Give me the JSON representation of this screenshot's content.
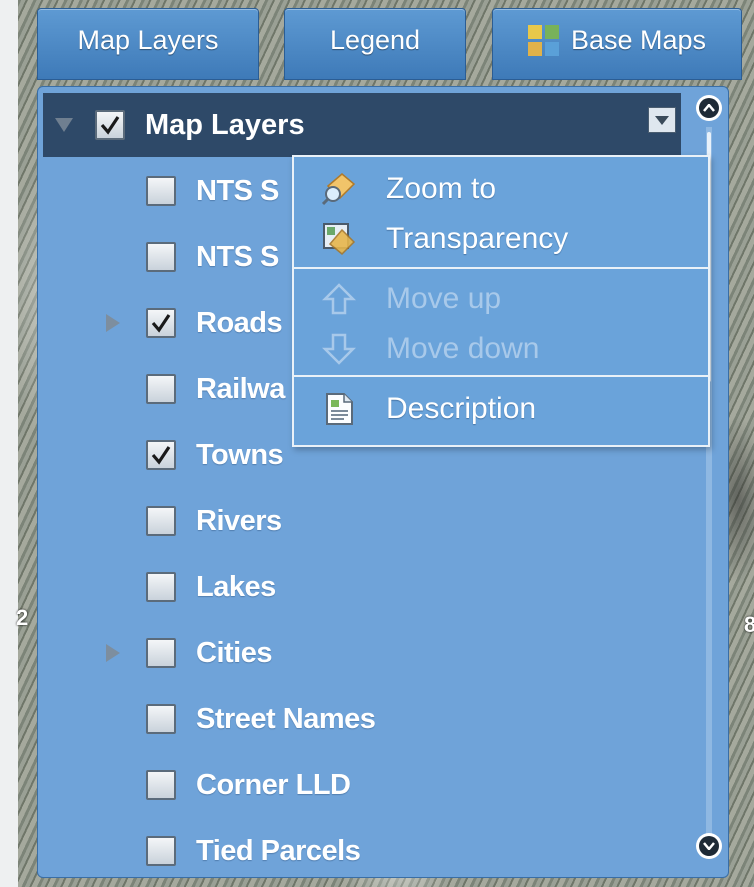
{
  "tabs": {
    "map_layers": "Map Layers",
    "legend": "Legend",
    "base_maps": "Base Maps"
  },
  "panel": {
    "title": "Map Layers",
    "title_checked": true
  },
  "layers": [
    {
      "label": "NTS S",
      "checked": false,
      "expandable": false
    },
    {
      "label": "NTS S",
      "checked": false,
      "expandable": false
    },
    {
      "label": "Roads",
      "checked": true,
      "expandable": true
    },
    {
      "label": "Railwa",
      "checked": false,
      "expandable": false
    },
    {
      "label": "Towns",
      "checked": true,
      "expandable": false
    },
    {
      "label": "Rivers",
      "checked": false,
      "expandable": false
    },
    {
      "label": "Lakes",
      "checked": false,
      "expandable": false
    },
    {
      "label": "Cities",
      "checked": false,
      "expandable": true
    },
    {
      "label": "Street Names",
      "checked": false,
      "expandable": false
    },
    {
      "label": "Corner LLD",
      "checked": false,
      "expandable": false
    },
    {
      "label": "Tied Parcels",
      "checked": false,
      "expandable": false
    }
  ],
  "context_menu": {
    "zoom_to": "Zoom to",
    "transparency": "Transparency",
    "move_up": "Move up",
    "move_down": "Move down",
    "description": "Description"
  },
  "map_labels": {
    "left": "2",
    "right": "8"
  },
  "colors": {
    "panel": "#6fa3d9",
    "header": "#2e4968",
    "tab": "#4f8cc9"
  }
}
